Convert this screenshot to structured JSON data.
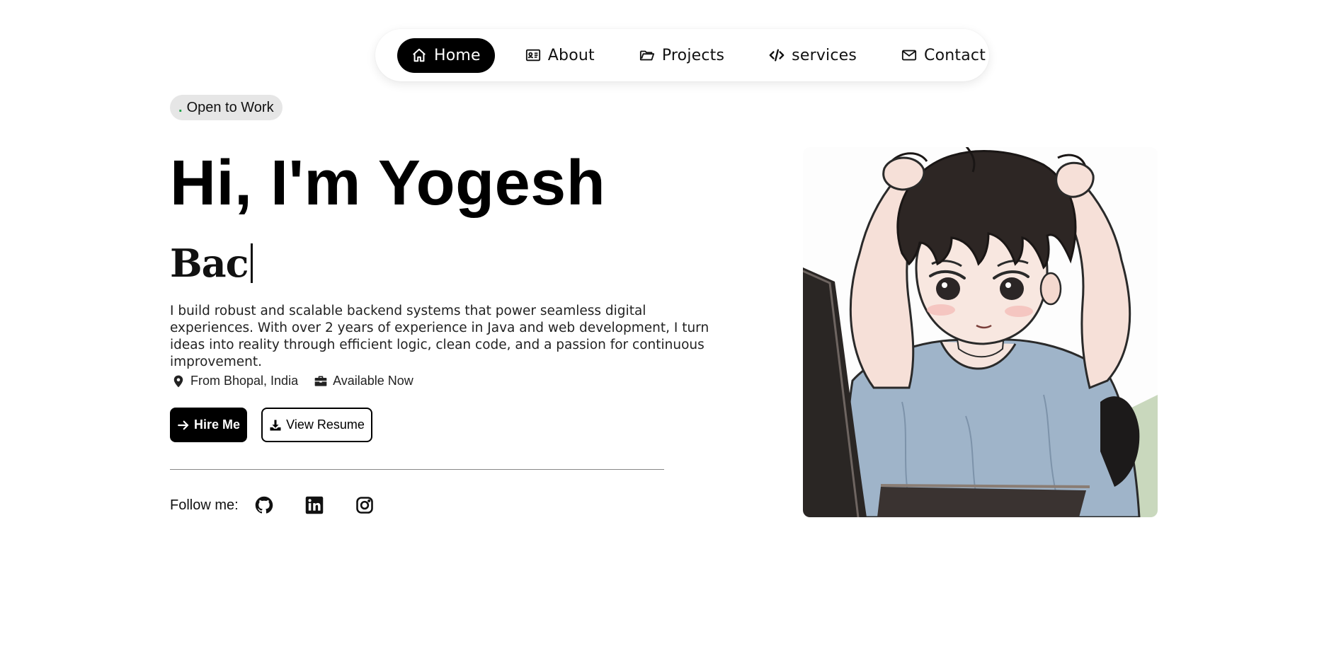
{
  "nav": {
    "items": [
      {
        "label": "Home",
        "icon": "home-icon",
        "active": true
      },
      {
        "label": "About",
        "icon": "id-card-icon",
        "active": false
      },
      {
        "label": "Projects",
        "icon": "folder-icon",
        "active": false
      },
      {
        "label": "services",
        "icon": "code-icon",
        "active": false
      },
      {
        "label": "Contact",
        "icon": "envelope-icon",
        "active": false
      }
    ]
  },
  "badge": {
    "dot": ".",
    "label": "Open to Work",
    "dot_color": "#22a34a"
  },
  "hero": {
    "title": "Hi, I'm Yogesh",
    "typed": "Bac",
    "description": "I build robust and scalable backend systems that power seamless digital experiences. With over 2 years of experience in Java and web development, I turn ideas into reality through efficient logic, clean code, and a passion for continuous improvement.",
    "location": "From Bhopal, India",
    "availability": "Available Now"
  },
  "buttons": {
    "hire": "Hire Me",
    "resume": "View Resume"
  },
  "follow": {
    "label": "Follow me:",
    "socials": [
      "github-icon",
      "linkedin-icon",
      "instagram-icon"
    ]
  },
  "colors": {
    "primary": "#000000",
    "background": "#ffffff",
    "badge_bg": "#e6e6e6",
    "shirt": "#9fb4c9"
  }
}
